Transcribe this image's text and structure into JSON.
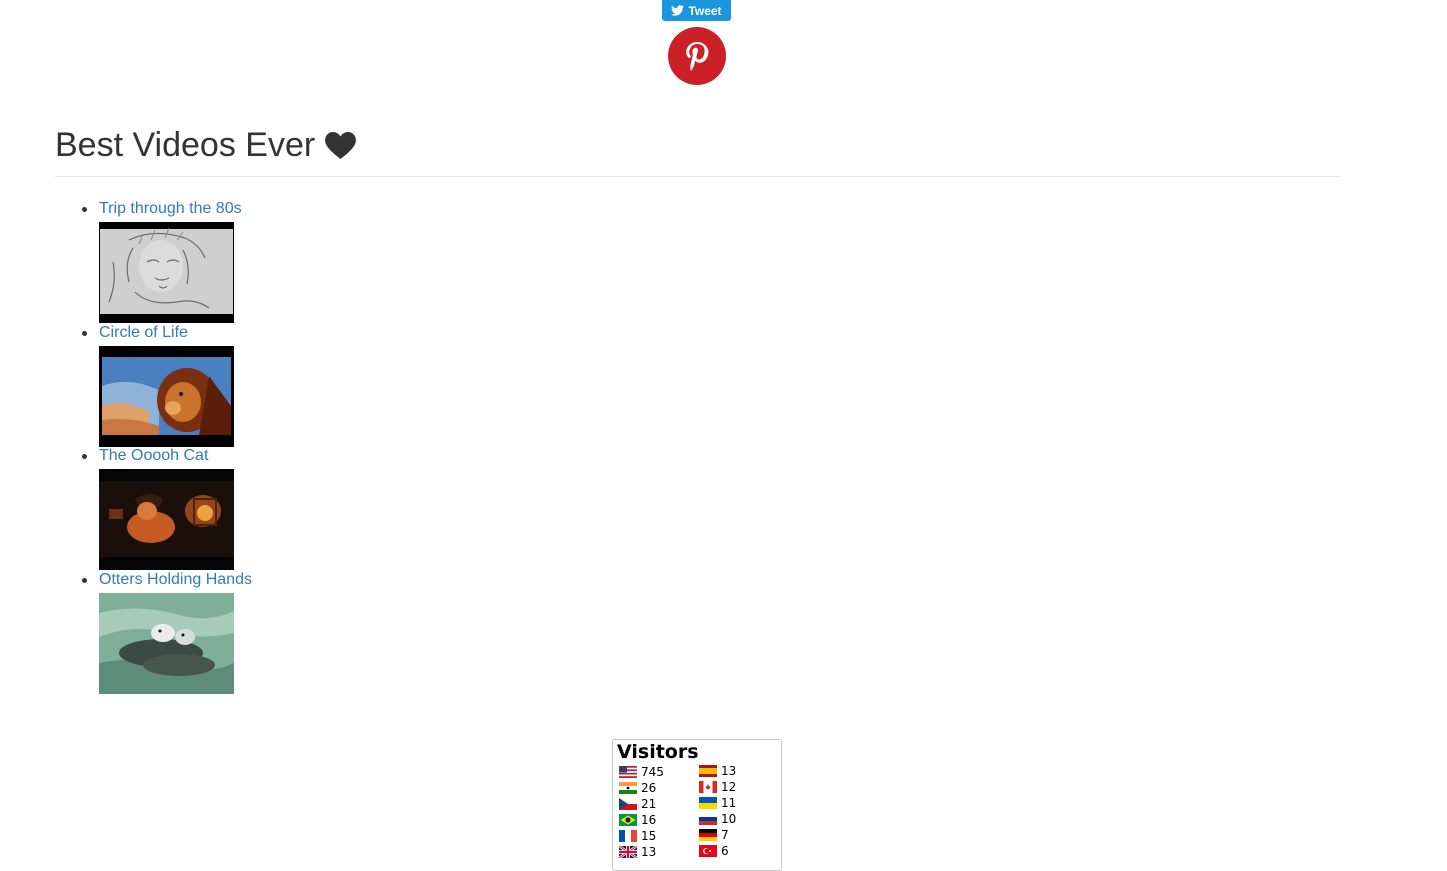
{
  "share": {
    "tweet_label": "Tweet",
    "twitter_color": "#1b95e0",
    "pinterest_color": "#cb2027"
  },
  "page": {
    "title": "Best Videos Ever",
    "title_icon": "heart-icon"
  },
  "videos": [
    {
      "title": "Trip through the 80s",
      "thumbnail": "pencil-sketch-face"
    },
    {
      "title": "Circle of Life",
      "thumbnail": "lion-king-simba"
    },
    {
      "title": "The Ooooh Cat",
      "thumbnail": "puss-in-boots-dark"
    },
    {
      "title": "Otters Holding Hands",
      "thumbnail": "otters-floating"
    }
  ],
  "visitors": {
    "title": "Visitors",
    "entries": [
      {
        "country": "US",
        "count": "745"
      },
      {
        "country": "IN",
        "count": "26"
      },
      {
        "country": "CZ",
        "count": "21"
      },
      {
        "country": "BR",
        "count": "16"
      },
      {
        "country": "FR",
        "count": "15"
      },
      {
        "country": "GB",
        "count": "13"
      },
      {
        "country": "ES",
        "count": "13"
      },
      {
        "country": "CA",
        "count": "12"
      },
      {
        "country": "UA",
        "count": "11"
      },
      {
        "country": "RU",
        "count": "10"
      },
      {
        "country": "DE",
        "count": "7"
      },
      {
        "country": "TR",
        "count": "6"
      }
    ]
  },
  "colors": {
    "link": "#337ab7",
    "text": "#333333"
  }
}
